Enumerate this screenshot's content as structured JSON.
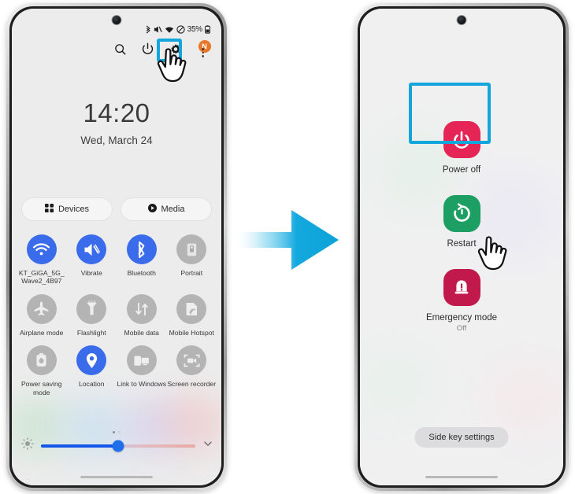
{
  "left_phone": {
    "name": "quick-settings-panel",
    "statusbar": {
      "icons": [
        "bluetooth-icon",
        "vibrate-icon",
        "wifi-icon",
        "do-not-disturb-icon"
      ],
      "battery_text": "35%",
      "battery_icon": "battery-icon"
    },
    "header_icons": [
      {
        "name": "search-icon",
        "glyph": "search"
      },
      {
        "name": "power-icon",
        "glyph": "power",
        "highlighted": true
      },
      {
        "name": "gear-icon",
        "glyph": "gear"
      },
      {
        "name": "more-options-icon",
        "glyph": "kebab",
        "badge": "N"
      }
    ],
    "clock": {
      "time": "14:20",
      "date": "Wed, March 24"
    },
    "pills": [
      {
        "label": "Devices",
        "icon": "devices-grid-icon"
      },
      {
        "label": "Media",
        "icon": "media-play-icon"
      }
    ],
    "tiles": [
      {
        "label": "KT_GiGA_5G_Wave2_4B97",
        "icon": "wifi-icon",
        "active": true
      },
      {
        "label": "Vibrate",
        "icon": "vibrate-icon",
        "active": true
      },
      {
        "label": "Bluetooth",
        "icon": "bluetooth-icon",
        "active": true
      },
      {
        "label": "Portrait",
        "icon": "rotation-lock-icon",
        "active": false
      },
      {
        "label": "Airplane mode",
        "icon": "airplane-icon",
        "active": false
      },
      {
        "label": "Flashlight",
        "icon": "flashlight-icon",
        "active": false
      },
      {
        "label": "Mobile data",
        "icon": "mobile-data-icon",
        "active": false
      },
      {
        "label": "Mobile Hotspot",
        "icon": "hotspot-icon",
        "active": false
      },
      {
        "label": "Power saving mode",
        "icon": "power-saving-icon",
        "active": false
      },
      {
        "label": "Location",
        "icon": "location-pin-icon",
        "active": true
      },
      {
        "label": "Link to Windows",
        "icon": "link-to-windows-icon",
        "active": false
      },
      {
        "label": "Screen recorder",
        "icon": "screen-recorder-icon",
        "active": false
      }
    ],
    "brightness": {
      "icon": "brightness-icon",
      "value_percent": 50,
      "expand_icon": "chevron-down-icon"
    }
  },
  "right_phone": {
    "name": "power-menu",
    "options": [
      {
        "label": "Power off",
        "sub": "",
        "icon": "power-off-icon",
        "color": "#e52555",
        "highlighted": false
      },
      {
        "label": "Restart",
        "sub": "",
        "icon": "restart-icon",
        "color": "#1d9e63",
        "highlighted": true
      },
      {
        "label": "Emergency mode",
        "sub": "Off",
        "icon": "emergency-mode-icon",
        "color": "#c2194d",
        "highlighted": false
      }
    ],
    "side_key_button": "Side key settings"
  },
  "annotations": {
    "highlight_color": "#13a6dc",
    "arrow_color": "#12a8dd",
    "cursor": "pointing-hand-cursor"
  }
}
